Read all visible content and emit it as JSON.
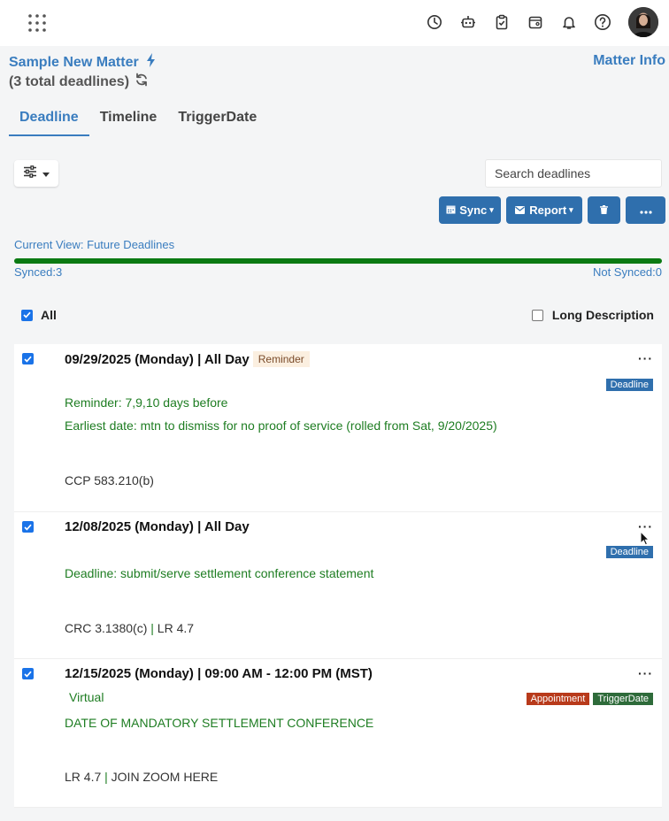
{
  "header": {
    "matter_title": "Sample New Matter",
    "matter_info": "Matter Info",
    "total_deadlines": "(3 total deadlines)"
  },
  "tabs": [
    {
      "label": "Deadline",
      "active": true
    },
    {
      "label": "Timeline",
      "active": false
    },
    {
      "label": "TriggerDate",
      "active": false
    }
  ],
  "toolbar": {
    "search_placeholder": "Search deadlines",
    "sync_label": "Sync",
    "report_label": "Report"
  },
  "status": {
    "current_view": "Current View: Future Deadlines",
    "synced": "Synced:3",
    "not_synced": "Not Synced:0",
    "synced_fraction": 1.0
  },
  "list_controls": {
    "all_label": "All",
    "all_checked": true,
    "long_description_label": "Long Description",
    "long_description_checked": false
  },
  "deadlines": [
    {
      "date_line": "09/29/2025 (Monday) | All Day",
      "reminder_chip": "Reminder",
      "badges": [
        "Deadline"
      ],
      "lines": [
        "Reminder: 7,9,10 days before",
        "Earliest date: mtn to dismiss for no proof of service (rolled from Sat, 9/20/2025)"
      ],
      "ref_parts": [
        "CCP 583.210(b)"
      ]
    },
    {
      "date_line": "12/08/2025 (Monday) | All Day",
      "badges": [
        "Deadline"
      ],
      "lines": [
        "Deadline: submit/serve settlement conference statement"
      ],
      "ref_parts": [
        "CRC 3.1380(c)",
        "LR 4.7"
      ]
    },
    {
      "date_line": "12/15/2025 (Monday) | 09:00 AM - 12:00 PM (MST)",
      "location": "Virtual",
      "badges": [
        "Appointment",
        "TriggerDate"
      ],
      "lines": [
        "DATE OF MANDATORY SETTLEMENT CONFERENCE"
      ],
      "ref_parts": [
        "LR 4.7",
        "JOIN ZOOM HERE"
      ]
    }
  ],
  "colors": {
    "accent": "#3a7dbf",
    "button": "#2f6fad",
    "progress": "#0b7a12",
    "green_text": "#1e7d22",
    "appointment": "#b83a1b",
    "trigger": "#2e6b3a"
  },
  "icons": [
    "app-grid-icon",
    "clock-icon",
    "robot-icon",
    "clipboard-check-icon",
    "calendar-icon",
    "bell-icon",
    "help-icon",
    "bolt-icon",
    "refresh-icon",
    "sliders-icon",
    "trash-icon",
    "more-icon"
  ]
}
